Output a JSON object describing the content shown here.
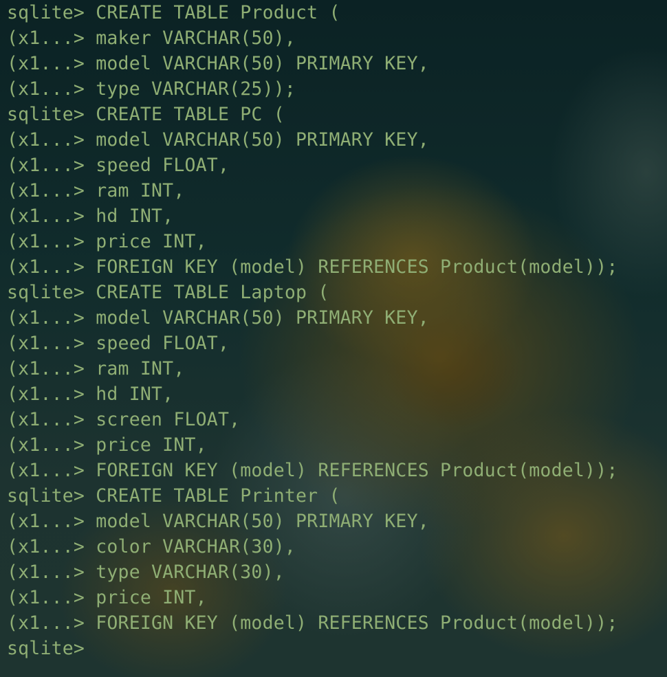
{
  "terminal": {
    "lines": [
      {
        "prompt": "sqlite> ",
        "text": "CREATE TABLE Product ("
      },
      {
        "prompt": "(x1...> ",
        "text": "maker VARCHAR(50),"
      },
      {
        "prompt": "(x1...> ",
        "text": "model VARCHAR(50) PRIMARY KEY,"
      },
      {
        "prompt": "(x1...> ",
        "text": "type VARCHAR(25));"
      },
      {
        "prompt": "sqlite> ",
        "text": "CREATE TABLE PC ("
      },
      {
        "prompt": "(x1...> ",
        "text": "model VARCHAR(50) PRIMARY KEY,"
      },
      {
        "prompt": "(x1...> ",
        "text": "speed FLOAT,"
      },
      {
        "prompt": "(x1...> ",
        "text": "ram INT,"
      },
      {
        "prompt": "(x1...> ",
        "text": "hd INT,"
      },
      {
        "prompt": "(x1...> ",
        "text": "price INT,"
      },
      {
        "prompt": "(x1...> ",
        "text": "FOREIGN KEY (model) REFERENCES Product(model));"
      },
      {
        "prompt": "sqlite> ",
        "text": "CREATE TABLE Laptop ("
      },
      {
        "prompt": "(x1...> ",
        "text": "model VARCHAR(50) PRIMARY KEY,"
      },
      {
        "prompt": "(x1...> ",
        "text": "speed FLOAT,"
      },
      {
        "prompt": "(x1...> ",
        "text": "ram INT,"
      },
      {
        "prompt": "(x1...> ",
        "text": "hd INT,"
      },
      {
        "prompt": "(x1...> ",
        "text": "screen FLOAT,"
      },
      {
        "prompt": "(x1...> ",
        "text": "price INT,"
      },
      {
        "prompt": "(x1...> ",
        "text": "FOREIGN KEY (model) REFERENCES Product(model));"
      },
      {
        "prompt": "sqlite> ",
        "text": "CREATE TABLE Printer ("
      },
      {
        "prompt": "(x1...> ",
        "text": "model VARCHAR(50) PRIMARY KEY,"
      },
      {
        "prompt": "(x1...> ",
        "text": "color VARCHAR(30),"
      },
      {
        "prompt": "(x1...> ",
        "text": "type VARCHAR(30),"
      },
      {
        "prompt": "(x1...> ",
        "text": "price INT,"
      },
      {
        "prompt": "(x1...> ",
        "text": "FOREIGN KEY (model) REFERENCES Product(model));"
      },
      {
        "prompt": "sqlite> ",
        "text": ""
      }
    ]
  },
  "colors": {
    "text": "#8fae74",
    "background": "#0e2a2b"
  }
}
